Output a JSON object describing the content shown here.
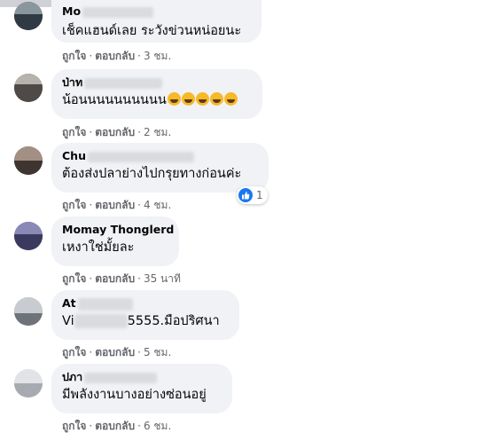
{
  "comments": [
    {
      "name": "Mo",
      "text": "เช็คแฮนด์เลย ระวังข่วนหน่อยนะ",
      "like": "ถูกใจ",
      "reply": "ตอบกลับ",
      "time": "3 ชม."
    },
    {
      "name": "ป่าท",
      "text": "น้อนนนนนนนนนน",
      "emojis": [
        "grinning-sweat-emoji",
        "laughing-emoji",
        "rofl-emoji",
        "rofl-emoji",
        "rofl-emoji"
      ],
      "like": "ถูกใจ",
      "reply": "ตอบกลับ",
      "time": "2 ชม."
    },
    {
      "name": "Chu",
      "text": "ต้องส่งปลาย่างไปกรุยทางก่อนค่ะ",
      "like": "ถูกใจ",
      "reply": "ตอบกลับ",
      "time": "4 ชม.",
      "reactions": "1"
    },
    {
      "name": "Momay Thonglerd",
      "text": "เหงาใช่มั้ยละ",
      "like": "ถูกใจ",
      "reply": "ตอบกลับ",
      "time": "35 นาที"
    },
    {
      "name": "At",
      "text_start": "Vi",
      "text_end": "5555.มือปริศนา",
      "like": "ถูกใจ",
      "reply": "ตอบกลับ",
      "time": "5 ชม."
    },
    {
      "name": "ปภา",
      "text": "มีพลังงานบางอย่างซ่อนอยู่",
      "like": "ถูกใจ",
      "reply": "ตอบกลับ",
      "time": "6 ชม."
    }
  ],
  "separator": "·",
  "colors": {
    "bubble": "#f0f2f5",
    "meta_text": "#65676b",
    "like_blue": "#1877f2",
    "emoji_yellow": "#f7b928"
  }
}
